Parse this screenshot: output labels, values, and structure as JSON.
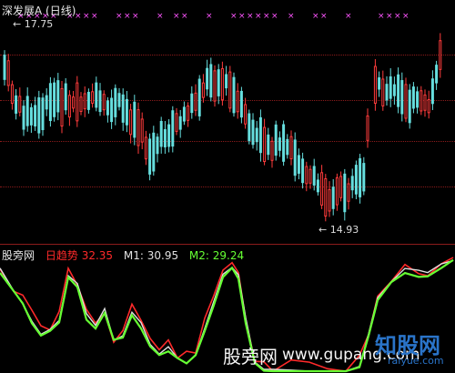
{
  "main": {
    "title": "深发展A (日线)",
    "high_label": "17.75",
    "low_label": "14.93"
  },
  "indicator": {
    "title": "股旁网",
    "series": [
      {
        "label": "日趋势",
        "value": "32.35",
        "color": "#ff2a2a"
      },
      {
        "label": "M1:",
        "value": "30.95",
        "color": "#e0e0e0"
      },
      {
        "label": "M2:",
        "value": "29.24",
        "color": "#66ff33"
      }
    ]
  },
  "watermark": {
    "text1": "股旁网",
    "text2": "www.gupang.com",
    "logo_text": "知股网",
    "logo_sub": "raiyue.com"
  },
  "colors": {
    "up": "#ff3b3b",
    "down": "#66dede",
    "grid": "#8b1b1b",
    "marker": "#ff55ff"
  }
}
